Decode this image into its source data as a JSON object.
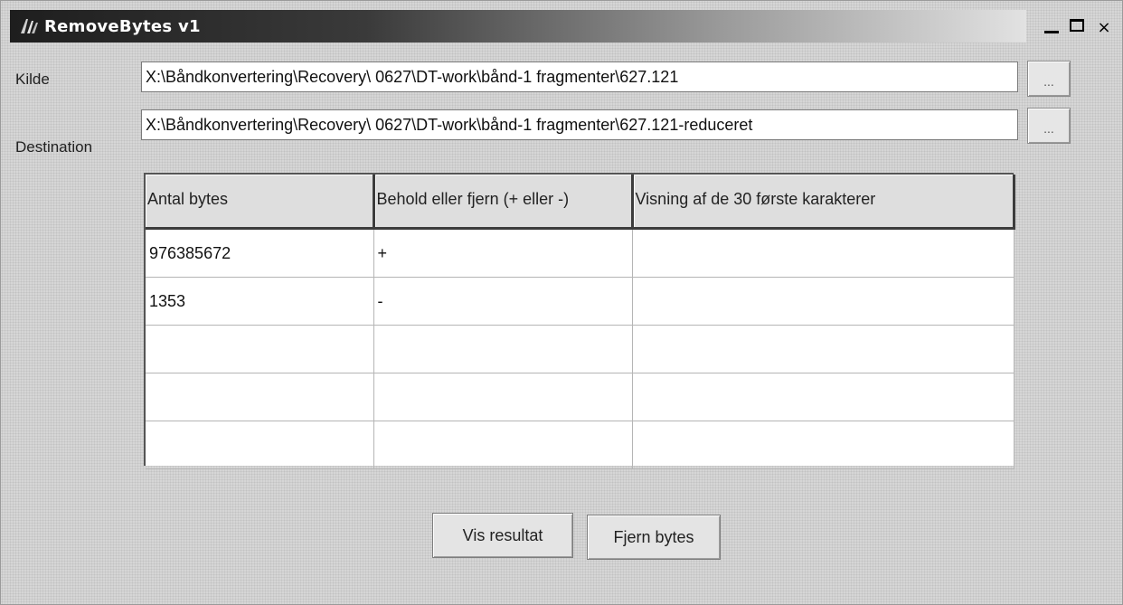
{
  "window": {
    "title": "RemoveBytes v1",
    "controls": {
      "minimize": "_",
      "maximize": "□",
      "close": "×"
    }
  },
  "source": {
    "label": "Kilde",
    "value": "X:\\Båndkonvertering\\Recovery\\ 0627\\DT-work\\bånd-1 fragmenter\\627.121",
    "browse_label": "..."
  },
  "destination": {
    "label": "Destination",
    "value": "X:\\Båndkonvertering\\Recovery\\ 0627\\DT-work\\bånd-1 fragmenter\\627.121-reduceret",
    "browse_label": "..."
  },
  "grid": {
    "columns": [
      "Antal bytes",
      "Behold eller fjern (+ eller -)",
      "Visning af de 30 første karakterer"
    ],
    "rows": [
      [
        "976385672",
        "+",
        ""
      ],
      [
        "1353",
        "-",
        ""
      ],
      [
        "",
        "",
        ""
      ],
      [
        "",
        "",
        ""
      ],
      [
        "",
        "",
        ""
      ]
    ]
  },
  "buttons": {
    "show_result": "Vis resultat",
    "remove_bytes": "Fjern bytes"
  },
  "colors": {
    "window_bg": "#d6d6d6",
    "title_text": "#ffffff"
  },
  "icons": [
    "app-icon",
    "minimize-icon",
    "maximize-icon",
    "close-icon"
  ]
}
